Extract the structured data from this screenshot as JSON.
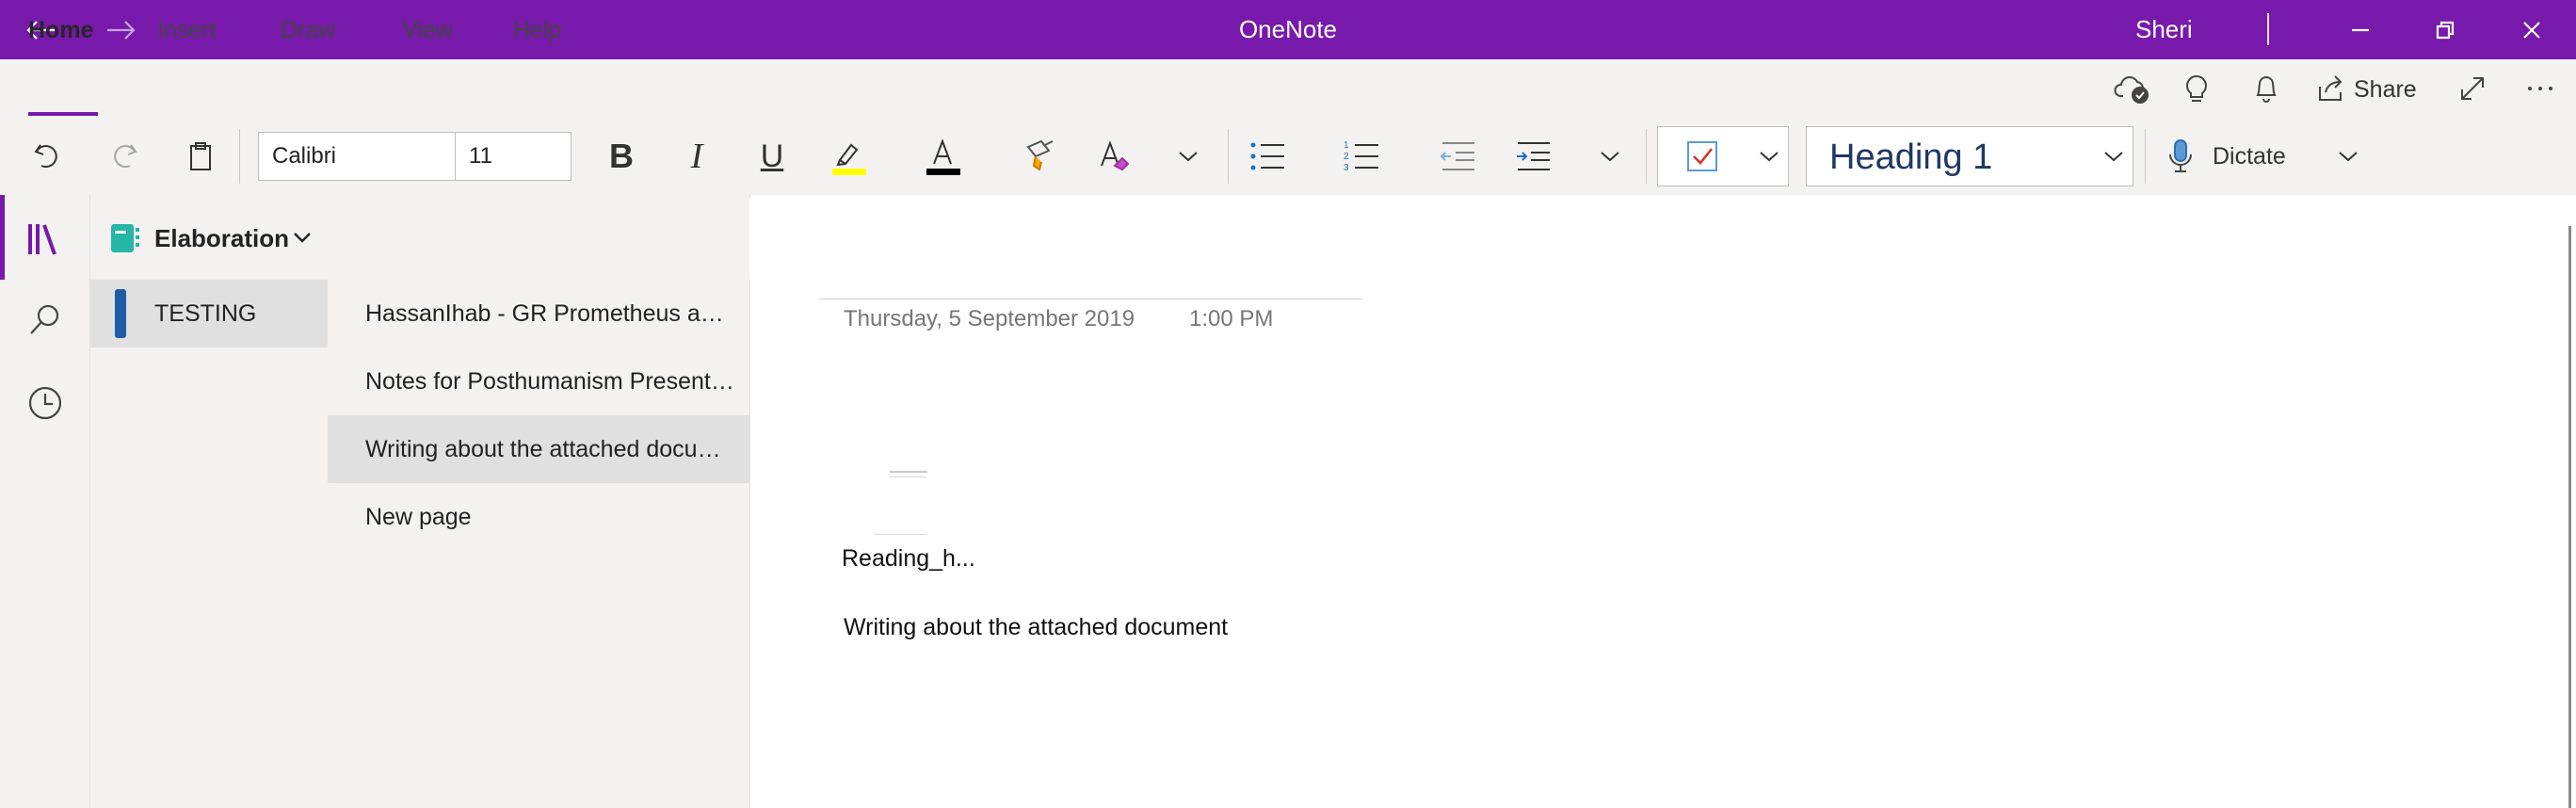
{
  "window": {
    "title": "OneNote",
    "user": "Sheri"
  },
  "ribbon": {
    "tabs": [
      {
        "label": "Home"
      },
      {
        "label": "Insert"
      },
      {
        "label": "Draw"
      },
      {
        "label": "View"
      },
      {
        "label": "Help"
      }
    ],
    "active_tab": "Home",
    "share_label": "Share"
  },
  "toolbar": {
    "font_name": "Calibri",
    "font_size": "11",
    "bold_glyph": "B",
    "italic_glyph": "I",
    "underline_glyph": "U",
    "font_color_glyph": "A",
    "highlight_color": "#ffff00",
    "font_color": "#000000",
    "style": "Heading 1",
    "dictate_label": "Dictate"
  },
  "notebook": {
    "name": "Elaboration",
    "sections": [
      {
        "label": "TESTING",
        "color": "#1e5ca8",
        "selected": true
      }
    ],
    "pages": [
      {
        "label": "HassanIhab - GR Prometheus and Frankenstein",
        "selected": false
      },
      {
        "label": "Notes for Posthumanism Presentation",
        "selected": false
      },
      {
        "label": "Writing about the attached document",
        "selected": true
      },
      {
        "label": "New page",
        "selected": false
      }
    ]
  },
  "page": {
    "date": "Thursday, 5 September 2019",
    "time": "1:00 PM",
    "attachment_label": "Reading_h...",
    "body_text": "Writing about the attached document"
  },
  "colors": {
    "accent": "#7719aa"
  }
}
